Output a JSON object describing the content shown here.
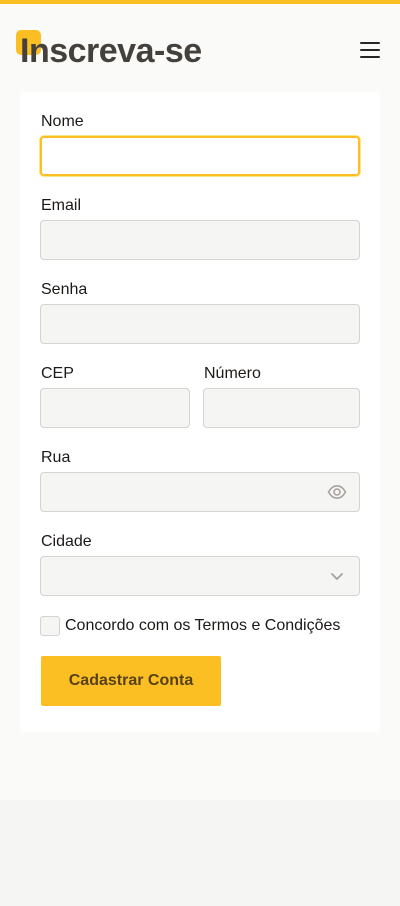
{
  "header": {
    "title": "Inscreva-se",
    "menu_icon": "hamburger-menu-icon"
  },
  "form": {
    "name": {
      "label": "Nome",
      "value": "",
      "focused": true
    },
    "email": {
      "label": "Email",
      "value": ""
    },
    "password": {
      "label": "Senha",
      "value": ""
    },
    "cep": {
      "label": "CEP",
      "value": ""
    },
    "number": {
      "label": "Número",
      "value": ""
    },
    "street": {
      "label": "Rua",
      "value": "",
      "icon": "eye-icon"
    },
    "city": {
      "label": "Cidade",
      "selected": "",
      "icon": "chevron-down-icon"
    },
    "terms": {
      "label": "Concordo com os Termos e Condições",
      "checked": false
    },
    "submit_label": "Cadastrar Conta"
  },
  "colors": {
    "accent": "#fbbf24",
    "title": "#44403c",
    "input_bg": "#f5f5f4",
    "button_text": "#57411a"
  }
}
